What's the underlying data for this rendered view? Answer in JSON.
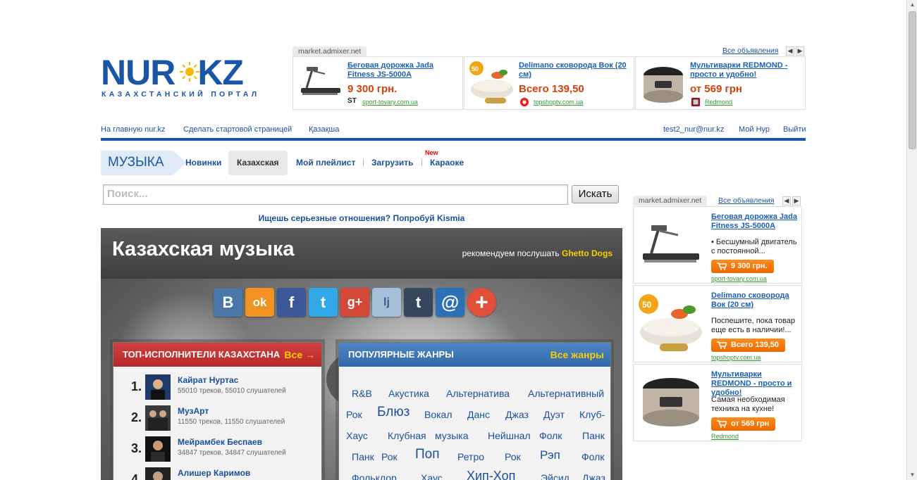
{
  "logo": {
    "brand_left": "NUR",
    "brand_right": "KZ",
    "tagline": "КАЗАХСТАНСКИЙ ПОРТАЛ"
  },
  "top_ad": {
    "source": "market.admixer.net",
    "all_link": "Все объявления",
    "items": [
      {
        "title": "Беговая дорожка Jada Fitness JS-5000A",
        "price": "9 300 грн.",
        "site": "sport-tovary.com.ua"
      },
      {
        "title": "Delimano сковорода Вок (20 см)",
        "price": "Всего 139,50",
        "site": "topshoptv.com.ua"
      },
      {
        "title": "Мультиварки REDMOND - просто и удобно!",
        "price": "от 569 грн",
        "site": "Redmond"
      }
    ]
  },
  "topnav": {
    "home": "На главную nur.kz",
    "start_page": "Сделать стартовой страницей",
    "kazakh": "Қазақша",
    "user": "test2_nur@nur.kz",
    "my_nur": "Мой Нур",
    "logout": "Выйти"
  },
  "music_nav": {
    "title": "МУЗЫКА",
    "new_items": "Новинки",
    "kazakh": "Казахская",
    "playlist": "Мой плейлист",
    "upload": "Загрузить",
    "karaoke": "Караоке",
    "new_badge": "New",
    "separator": "|"
  },
  "search": {
    "placeholder": "Поиск...",
    "button": "Искать"
  },
  "promo": "Ищешь серьезные отношения? Попробуй Kismia",
  "hero": {
    "title": "Казахская музыка",
    "recommend_prefix": "рекомендуем послушать",
    "recommend_artist": "Ghetto Dogs"
  },
  "social": {
    "labels": {
      "vk": "B",
      "ok": "ok",
      "fb": "f",
      "tw": "t",
      "gp": "g+",
      "lj": "lj",
      "tumblr": "t",
      "mail": "@",
      "more": "+"
    },
    "colors": {
      "vk": "#4a76a8",
      "ok": "#f29222",
      "fb": "#3b5998",
      "tw": "#31a9e8",
      "gp": "#d34836",
      "lj": "#a6bfd8",
      "tumblr": "#36465d",
      "mail": "#2c71b8",
      "more": "#e24e37"
    }
  },
  "top_artists": {
    "title": "ТОП-ИСПОЛНИТЕЛИ КАЗАХСТАНА",
    "all": "Все →",
    "items": [
      {
        "rank": "1.",
        "name": "Кайрат Нуртас",
        "stats": "55010 треков, 55010 слушателей"
      },
      {
        "rank": "2.",
        "name": "МузАрт",
        "stats": "11550 треков, 11550 слушателей"
      },
      {
        "rank": "3.",
        "name": "Мейрамбек Беспаев",
        "stats": "34847 треков, 34847 слушателей"
      },
      {
        "rank": "4.",
        "name": "Алишер Каримов",
        "stats": ""
      }
    ]
  },
  "genres": {
    "title": "ПОПУЛЯРНЫЕ ЖАНРЫ",
    "all": "Все жанры",
    "items": [
      "R&B",
      "Акустика",
      "Альтернатива",
      "Альтернативный",
      "Рок",
      "Блюз",
      "Вокал",
      "Данс",
      "Джаз",
      "Дуэт",
      "Клуб-",
      "Хаус",
      "Клубная",
      "музыка",
      "Нейшнал",
      "Фолк",
      "Панк",
      "Панк",
      "Рок",
      "Поп",
      "Ретро",
      "Рок",
      "Рэп",
      "Фолк",
      "Фольклор",
      "Хаус",
      "Хип-Хоп",
      "Эйсид",
      "Джаз"
    ]
  },
  "right_ad": {
    "source": "market.admixer.net",
    "all_link": "Все объявления",
    "items": [
      {
        "title": "Беговая дорожка Jada Fitness JS-5000A",
        "desc": "• Бесшумный двигатель с постоянной...",
        "price": "9 300 грн.",
        "site": "sport-tovary.com.ua"
      },
      {
        "title": "Delimano сковорода Вок (20 см)",
        "desc": "Поспешите, пока товар еще есть в наличии!...",
        "price": "Всего 139,50",
        "site": "topshoptv.com.ua"
      },
      {
        "title": "Мультиварки REDMOND - просто и удобно!",
        "desc": "Самая необходимая техника на кухне!",
        "price": "от 569 грн",
        "site": "Redmond"
      }
    ]
  },
  "colors": {
    "brand_blue": "#1a56a6",
    "link_blue": "#1a4f9c",
    "price_orange": "#d4420b",
    "accent_yellow": "#f5d000",
    "red_head": "#c23434",
    "blue_head": "#3b74b6"
  }
}
